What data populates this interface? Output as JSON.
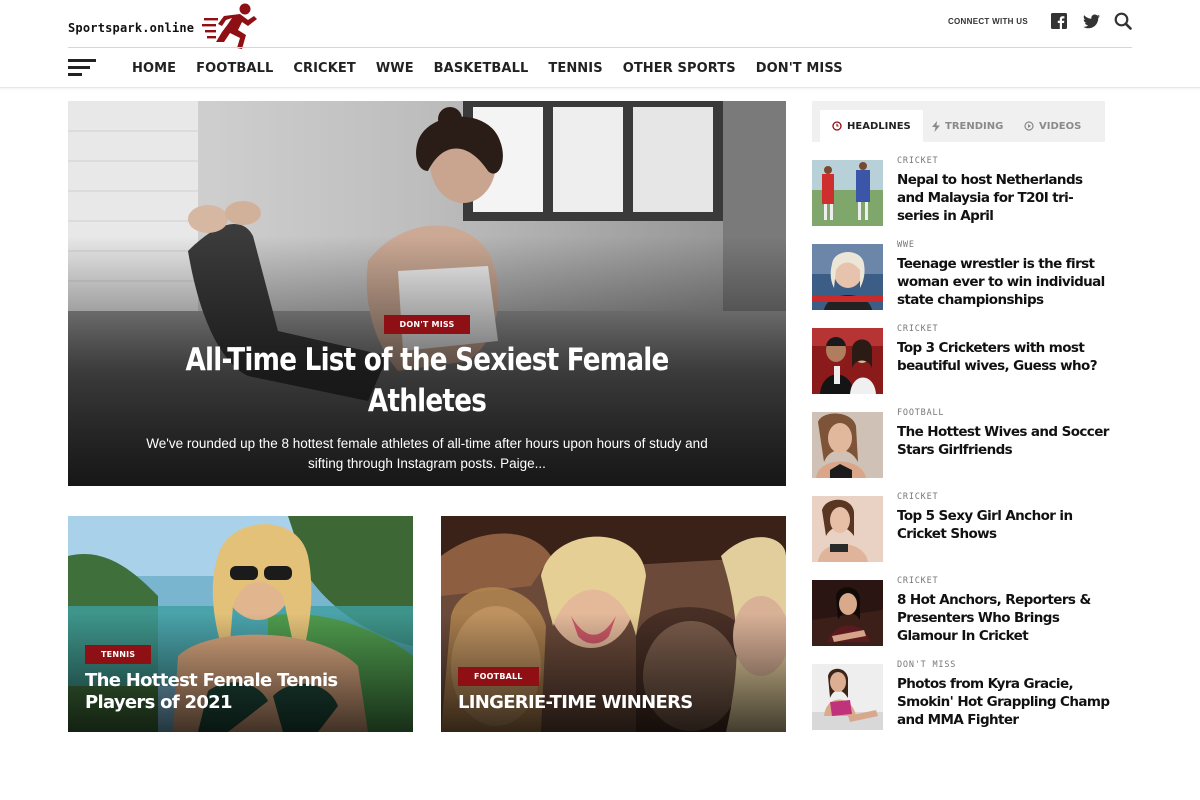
{
  "site": {
    "name": "Sportspark.online"
  },
  "header": {
    "connect_label": "CONNECT WITH US",
    "icons": [
      "facebook-icon",
      "twitter-icon",
      "search-icon"
    ]
  },
  "nav": {
    "items": [
      "HOME",
      "FOOTBALL",
      "CRICKET",
      "WWE",
      "BASKETBALL",
      "TENNIS",
      "OTHER SPORTS",
      "DON'T MISS"
    ]
  },
  "hero": {
    "category": "DON'T MISS",
    "title": "All-Time List of the Sexiest Female Athletes",
    "excerpt": "We've rounded up the 8 hottest female athletes of all-time after hours upon hours of study and sifting through Instagram posts. Paige..."
  },
  "cards": [
    {
      "category": "TENNIS",
      "title": "The Hottest Female Tennis Players of 2021"
    },
    {
      "category": "FOOTBALL",
      "title": "LINGERIE-TIME WINNERS"
    }
  ],
  "sidebar": {
    "tabs": [
      {
        "label": "HEADLINES",
        "icon": "clock-icon",
        "active": true
      },
      {
        "label": "TRENDING",
        "icon": "bolt-icon",
        "active": false
      },
      {
        "label": "VIDEOS",
        "icon": "play-icon",
        "active": false
      }
    ],
    "items": [
      {
        "category": "CRICKET",
        "title": "Nepal to host Netherlands and Malaysia for T20I tri-series in April"
      },
      {
        "category": "WWE",
        "title": "Teenage wrestler is the first woman ever to win individual state championships"
      },
      {
        "category": "CRICKET",
        "title": "Top 3 Cricketers with most beautiful wives, Guess who?"
      },
      {
        "category": "FOOTBALL",
        "title": "The Hottest Wives and Soccer Stars Girlfriends"
      },
      {
        "category": "CRICKET",
        "title": "Top 5 Sexy Girl Anchor in Cricket Shows"
      },
      {
        "category": "CRICKET",
        "title": "8 Hot Anchors, Reporters & Presenters Who Brings Glamour In Cricket"
      },
      {
        "category": "DON'T MISS",
        "title": "Photos from Kyra Gracie, Smokin' Hot Grappling Champ and MMA Fighter"
      }
    ]
  },
  "colors": {
    "accent": "#8f1014",
    "text": "#111111",
    "muted": "#8a8a8a",
    "tab_bg": "#f0f0f0"
  }
}
